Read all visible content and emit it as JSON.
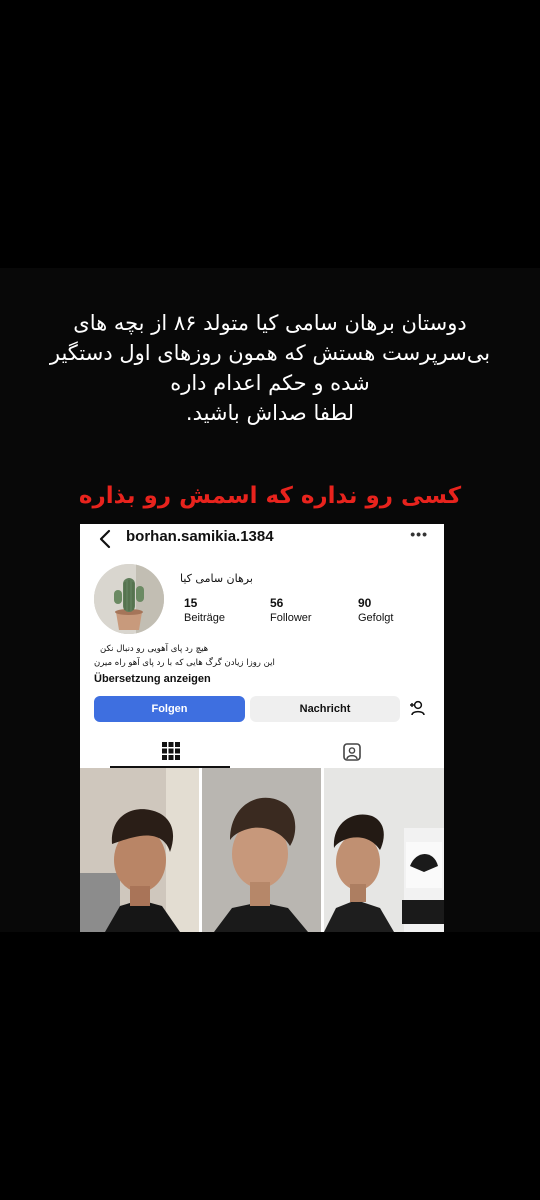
{
  "caption": {
    "lines": [
      "دوستان برهان سامی کیا متولد ۸۶ از بچه های",
      "بی‌سرپرست هستش که همون روزهای اول دستگیر",
      "شده و حکم اعدام داره",
      "لطفا صداش باشید."
    ],
    "alert": "کسی رو نداره که اسمش رو بذاره",
    "alert_color": "#e8231d"
  },
  "profile": {
    "username": "borhan.samikia.1384",
    "display_name": "برهان سامی کیا",
    "stats": [
      {
        "value": "15",
        "label": "Beiträge"
      },
      {
        "value": "56",
        "label": "Follower"
      },
      {
        "value": "90",
        "label": "Gefolgt"
      }
    ],
    "bio": [
      "هیچ رد پای آهویی رو دنبال نکن",
      "این روزا زیادن گرگ هایی که با رد پای آهو راه میرن"
    ],
    "translate_label": "Übersetzung anzeigen",
    "follow_label": "Folgen",
    "message_label": "Nachricht",
    "follow_color": "#3e6fe0",
    "icons": [
      "back-arrow-icon",
      "more-icon",
      "add-person-icon",
      "grid-icon",
      "tagged-icon"
    ]
  }
}
